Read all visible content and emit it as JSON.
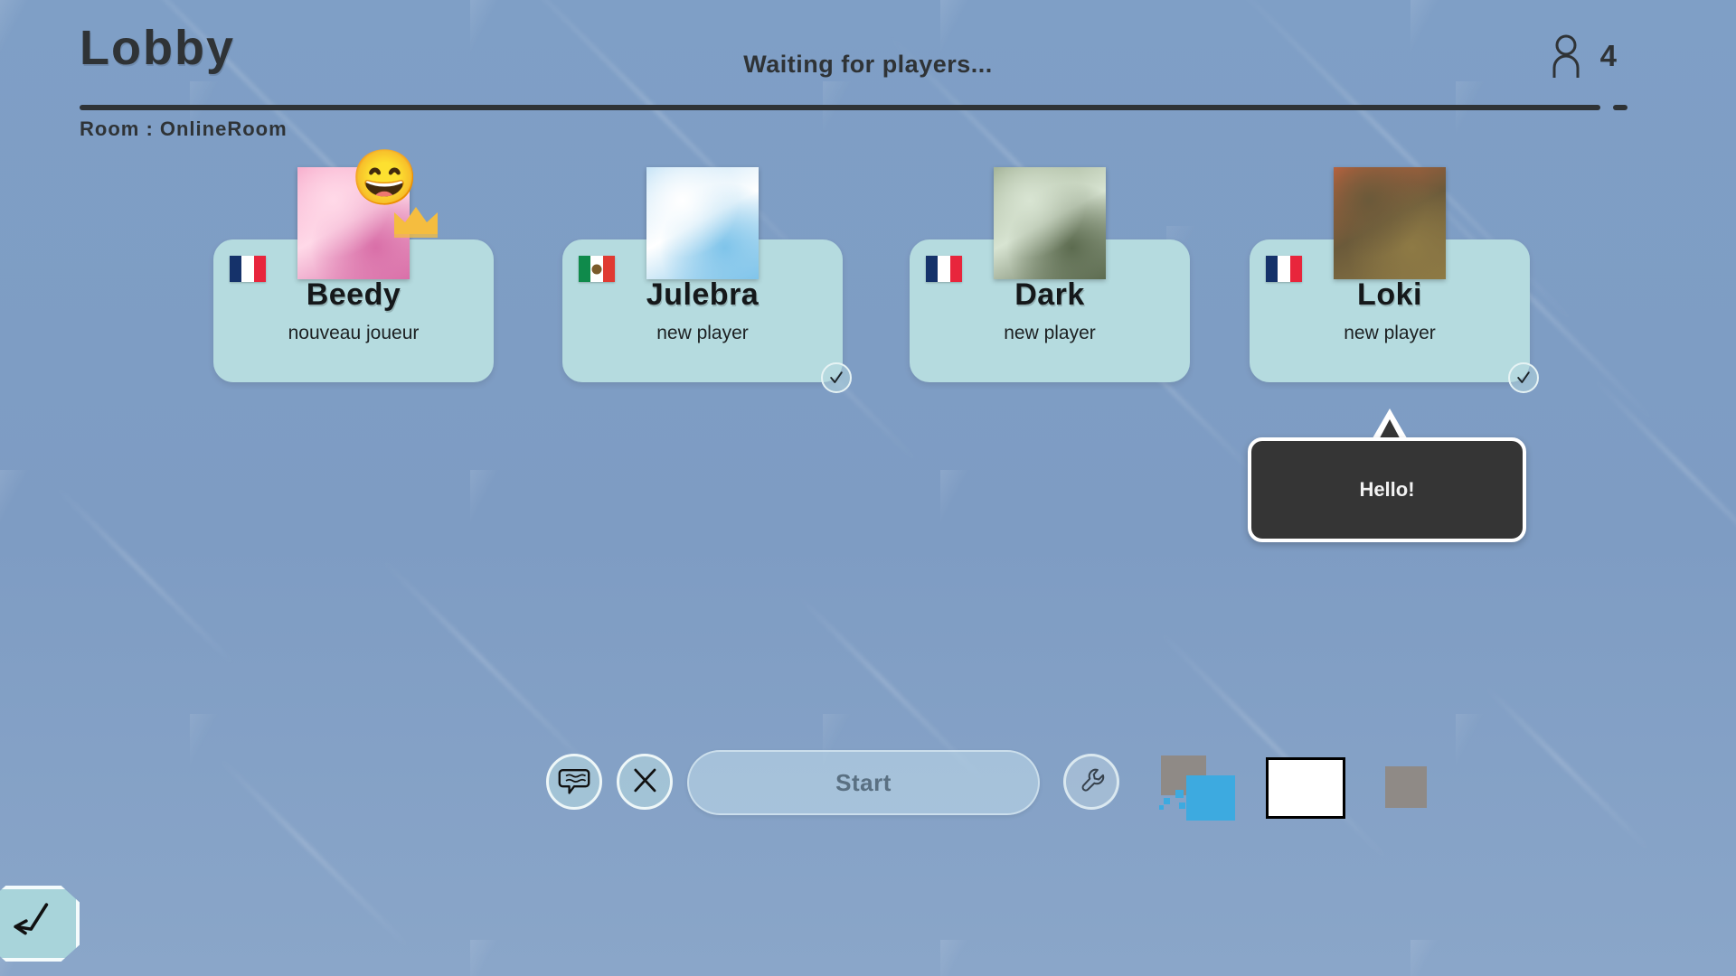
{
  "header": {
    "title": "Lobby",
    "status": "Waiting for players...",
    "player_count": "4",
    "person_icon": "person-icon",
    "room_label": "Room : OnlineRoom"
  },
  "players": [
    {
      "name": "Beedy",
      "status": "nouveau joueur",
      "country": "France",
      "flag_colors": [
        "#15326a",
        "#ffffff",
        "#e8253c"
      ],
      "avatar_colors": [
        "#f6a7c8",
        "#ffd9e8",
        "#d96fa8"
      ],
      "avatar_name": "sylveon-avatar",
      "is_host": true,
      "crown_color": "#f5bd3f",
      "ready": false,
      "emoji": "😄",
      "emoji_name": "grinning-emoji"
    },
    {
      "name": "Julebra",
      "status": "new player",
      "country": "Mexico",
      "flag_colors": [
        "#0f8a4b",
        "#ffffff",
        "#e03a32"
      ],
      "avatar_colors": [
        "#bcdff5",
        "#ffffff",
        "#7fc4ea"
      ],
      "avatar_name": "glaceon-avatar",
      "is_host": false,
      "ready": true,
      "emoji": "",
      "emoji_name": ""
    },
    {
      "name": "Dark",
      "status": "new player",
      "country": "France",
      "flag_colors": [
        "#15326a",
        "#ffffff",
        "#e8253c"
      ],
      "avatar_colors": [
        "#9aaa8d",
        "#d8e4d2",
        "#5c6b4f"
      ],
      "avatar_name": "window-photo-avatar",
      "is_host": false,
      "ready": false,
      "emoji": "",
      "emoji_name": ""
    },
    {
      "name": "Loki",
      "status": "new player",
      "country": "France",
      "flag_colors": [
        "#15326a",
        "#ffffff",
        "#e8253c"
      ],
      "avatar_colors": [
        "#c4633f",
        "#6b5a3a",
        "#8e7a45"
      ],
      "avatar_name": "anime-character-avatar",
      "is_host": false,
      "ready": true,
      "emoji": "",
      "emoji_name": ""
    }
  ],
  "chat": {
    "message": "Hello!",
    "author": "Loki"
  },
  "toolbar": {
    "chat_button": "chat-bubble-icon",
    "close_button": "close-x-icon",
    "start_label": "Start",
    "settings_button": "wrench-icon",
    "swatches": [
      {
        "name": "grey-swatch-a",
        "color": "#8f8a86"
      },
      {
        "name": "blue-swatch",
        "color": "#3daae0"
      },
      {
        "name": "white-swatch",
        "color": "#ffffff"
      },
      {
        "name": "grey-swatch-b",
        "color": "#8f8a86"
      }
    ]
  },
  "back_button": {
    "name": "back-arrow-icon"
  },
  "theme": {
    "background": "#7f9fc6",
    "card": "#b5dbdf",
    "ink": "#2f3336",
    "bubble": "#353535"
  }
}
